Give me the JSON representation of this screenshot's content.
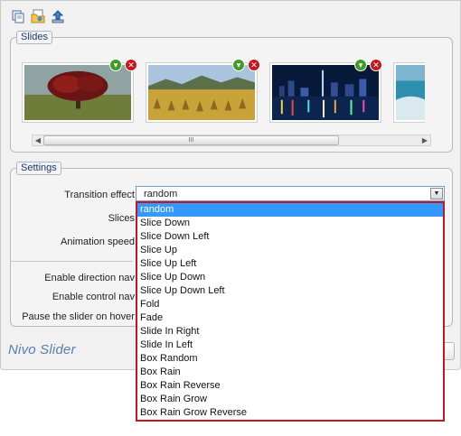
{
  "toolbar": {
    "icons": [
      "copy-icon",
      "open-folder-icon",
      "upload-icon"
    ]
  },
  "slides": {
    "legend": "Slides",
    "items": [
      {
        "thumb": "tree-landscape"
      },
      {
        "thumb": "hay-field-landscape"
      },
      {
        "thumb": "city-night-skyline"
      },
      {
        "thumb": "beach-coast"
      }
    ],
    "scrollbar_grip": "III"
  },
  "settings": {
    "legend": "Settings",
    "transition_label": "Transition effect:",
    "transition_value": "random",
    "slices_label": "Slices:",
    "animation_speed_label": "Animation speed:",
    "direction_nav_label": "Enable direction nav:",
    "control_nav_label": "Enable control nav:",
    "pause_hover_label": "Pause the slider on hover:"
  },
  "dropdown": {
    "options": [
      "random",
      "Slice Down",
      "Slice Down Left",
      "Slice Up",
      "Slice Up Left",
      "Slice Up Down",
      "Slice Up Down Left",
      "Fold",
      "Fade",
      "Slide In Right",
      "Slide In Left",
      "Box Random",
      "Box Rain",
      "Box Rain Reverse",
      "Box Rain Grow",
      "Box Rain Grow Reverse"
    ],
    "selected_index": 0
  },
  "footer": {
    "brand": "Nivo Slider"
  },
  "colors": {
    "accent": "#3399ff",
    "dropdown_border": "#c4161c",
    "brand_text": "#5a7fae"
  }
}
